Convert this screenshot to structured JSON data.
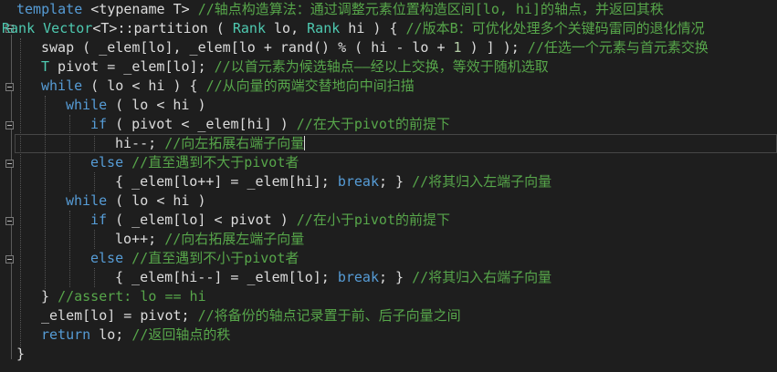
{
  "code": {
    "l1": {
      "p1": "template ",
      "p2": "<typename T> ",
      "cm": "//轴点构造算法：通过调整元素位置构造区间[lo, hi]的轴点，并返回其秩"
    },
    "l2": {
      "ty1": "Rank ",
      "ty2": "Vector",
      "p1": "<T>",
      "p2": "::partition ( ",
      "ty3": "Rank",
      "p3": " lo, ",
      "ty4": "Rank",
      "p4": " hi ) { ",
      "cm": "//版本B：可优化处理多个关键码雷同的退化情况"
    },
    "l3": {
      "p1": "swap ( _elem[lo], _elem[lo + rand() % ( hi - lo + ",
      "nm": "1",
      "p2": " ) ] ); ",
      "cm": "//任选一个元素与首元素交换"
    },
    "l4": {
      "ty": "T",
      "p1": " pivot = _elem[lo]; ",
      "cm": "//以首元素为候选轴点——经以上交换，等效于随机选取"
    },
    "l5": {
      "kw": "while",
      "p1": " ( lo < hi ) { ",
      "cm": "//从向量的两端交替地向中间扫描"
    },
    "l6": {
      "kw": "while",
      "p1": " ( lo < hi )"
    },
    "l7": {
      "kw": "if",
      "p1": " ( pivot < _elem[hi] ) ",
      "cm": "//在大于pivot的前提下"
    },
    "l8": {
      "p1": "hi--; ",
      "cm": "//向左拓展右端子向量"
    },
    "l9": {
      "kw": "else",
      "p1": " ",
      "cm": "//直至遇到不大于pivot者"
    },
    "l10": {
      "p1": "{ _elem[lo++] = _elem[hi]; ",
      "kw": "break",
      "p2": "; } ",
      "cm": "//将其归入左端子向量"
    },
    "l11": {
      "kw": "while",
      "p1": " ( lo < hi )"
    },
    "l12": {
      "kw": "if",
      "p1": " ( _elem[lo] < pivot ) ",
      "cm": "//在小于pivot的前提下"
    },
    "l13": {
      "p1": "lo++; ",
      "cm": "//向右拓展左端子向量"
    },
    "l14": {
      "kw": "else",
      "p1": " ",
      "cm": "//直至遇到不小于pivot者"
    },
    "l15": {
      "p1": "{ _elem[hi--] = _elem[lo]; ",
      "kw": "break",
      "p2": "; } ",
      "cm": "//将其归入右端子向量"
    },
    "l16": {
      "p1": "} ",
      "cm": "//assert: lo == hi"
    },
    "l17": {
      "p1": "_elem[lo] = pivot; ",
      "cm": "//将备份的轴点记录置于前、后子向量之间"
    },
    "l18": {
      "kw": "return",
      "p1": " lo; ",
      "cm": "//返回轴点的秩"
    },
    "l19": {
      "p1": "}"
    }
  },
  "colors": {
    "background": "#1e1e1e",
    "keyword": "#569cd6",
    "comment": "#57a64a",
    "type": "#4ec9b0",
    "number": "#b5cea8",
    "text": "#dcdcdc"
  }
}
